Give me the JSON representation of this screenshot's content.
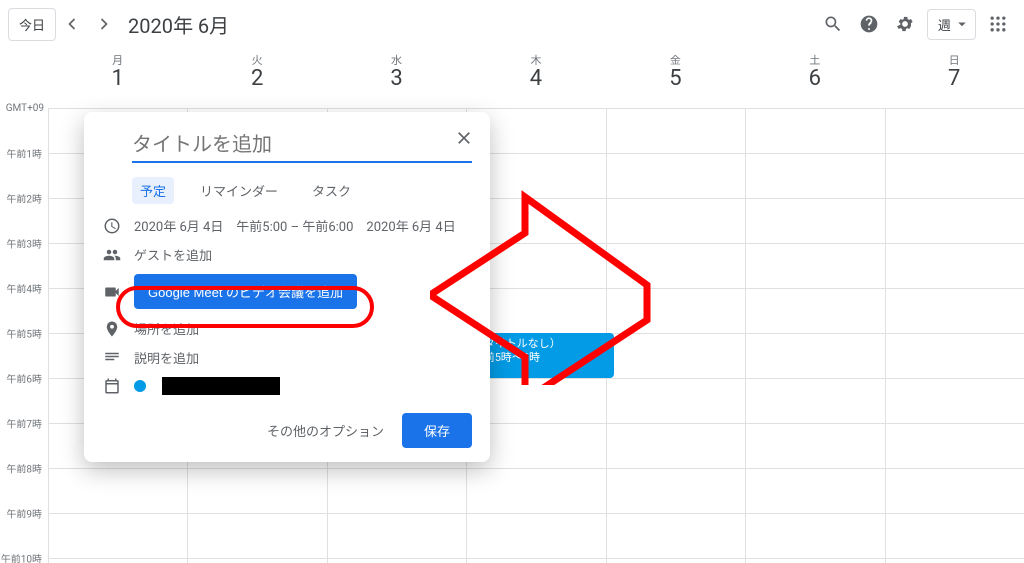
{
  "header": {
    "today": "今日",
    "title": "2020年 6月",
    "view": "週"
  },
  "timezone": "GMT+09",
  "hours": [
    "午前1時",
    "午前2時",
    "午前3時",
    "午前4時",
    "午前5時",
    "午前6時",
    "午前7時",
    "午前8時",
    "午前9時",
    "午前10時"
  ],
  "days": [
    {
      "dow": "月",
      "dom": "1"
    },
    {
      "dow": "火",
      "dom": "2"
    },
    {
      "dow": "水",
      "dom": "3"
    },
    {
      "dow": "木",
      "dom": "4"
    },
    {
      "dow": "金",
      "dom": "5"
    },
    {
      "dow": "土",
      "dom": "6"
    },
    {
      "dow": "日",
      "dom": "7"
    }
  ],
  "event": {
    "title": "（タイトルなし）",
    "time": "午前5時～6時"
  },
  "dialog": {
    "title_placeholder": "タイトルを追加",
    "tabs": {
      "event": "予定",
      "reminder": "リマインダー",
      "task": "タスク"
    },
    "datetime": "2020年 6月 4日　午前5:00  –  午前6:00　2020年 6月 4日",
    "guests": "ゲストを追加",
    "meet": "Google Meet のビデオ会議を追加",
    "location": "場所を追加",
    "description": "説明を追加",
    "more": "その他のオプション",
    "save": "保存"
  }
}
